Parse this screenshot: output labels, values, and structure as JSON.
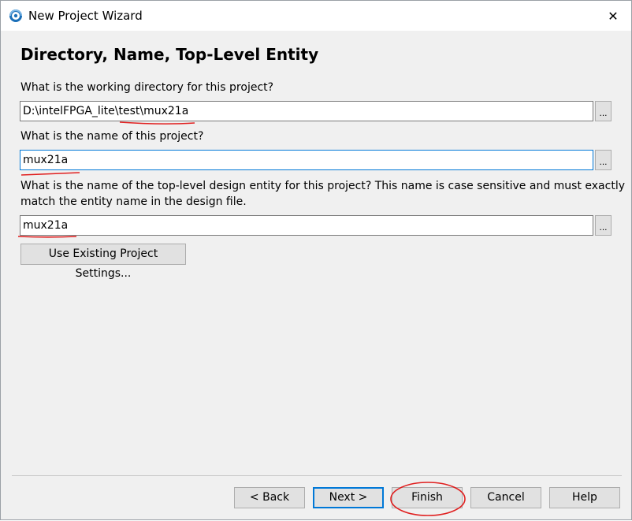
{
  "window": {
    "title": "New Project Wizard",
    "close_glyph": "✕"
  },
  "page": {
    "heading": "Directory, Name, Top-Level Entity",
    "dir_label": "What is the working directory for this project?",
    "dir_value": "D:\\intelFPGA_lite\\test\\mux21a",
    "name_label": "What is the name of this project?",
    "name_value": "mux21a",
    "entity_label_line1": "What is the name of the top-level design entity for this project? This name is case sensitive and must exactly",
    "entity_label_line2": "match the entity name in the design file.",
    "entity_value": "mux21a",
    "browse_label": "...",
    "use_existing_label": "Use Existing Project Settings..."
  },
  "footer": {
    "back_label": "< Back",
    "next_label": "Next >",
    "finish_label": "Finish",
    "cancel_label": "Cancel",
    "help_label": "Help"
  },
  "colors": {
    "annotation": "#e02020",
    "focus": "#0078d7",
    "dialog_bg": "#f0f0f0"
  },
  "icons": {
    "app": "quartus-app-icon",
    "close": "close-icon"
  }
}
